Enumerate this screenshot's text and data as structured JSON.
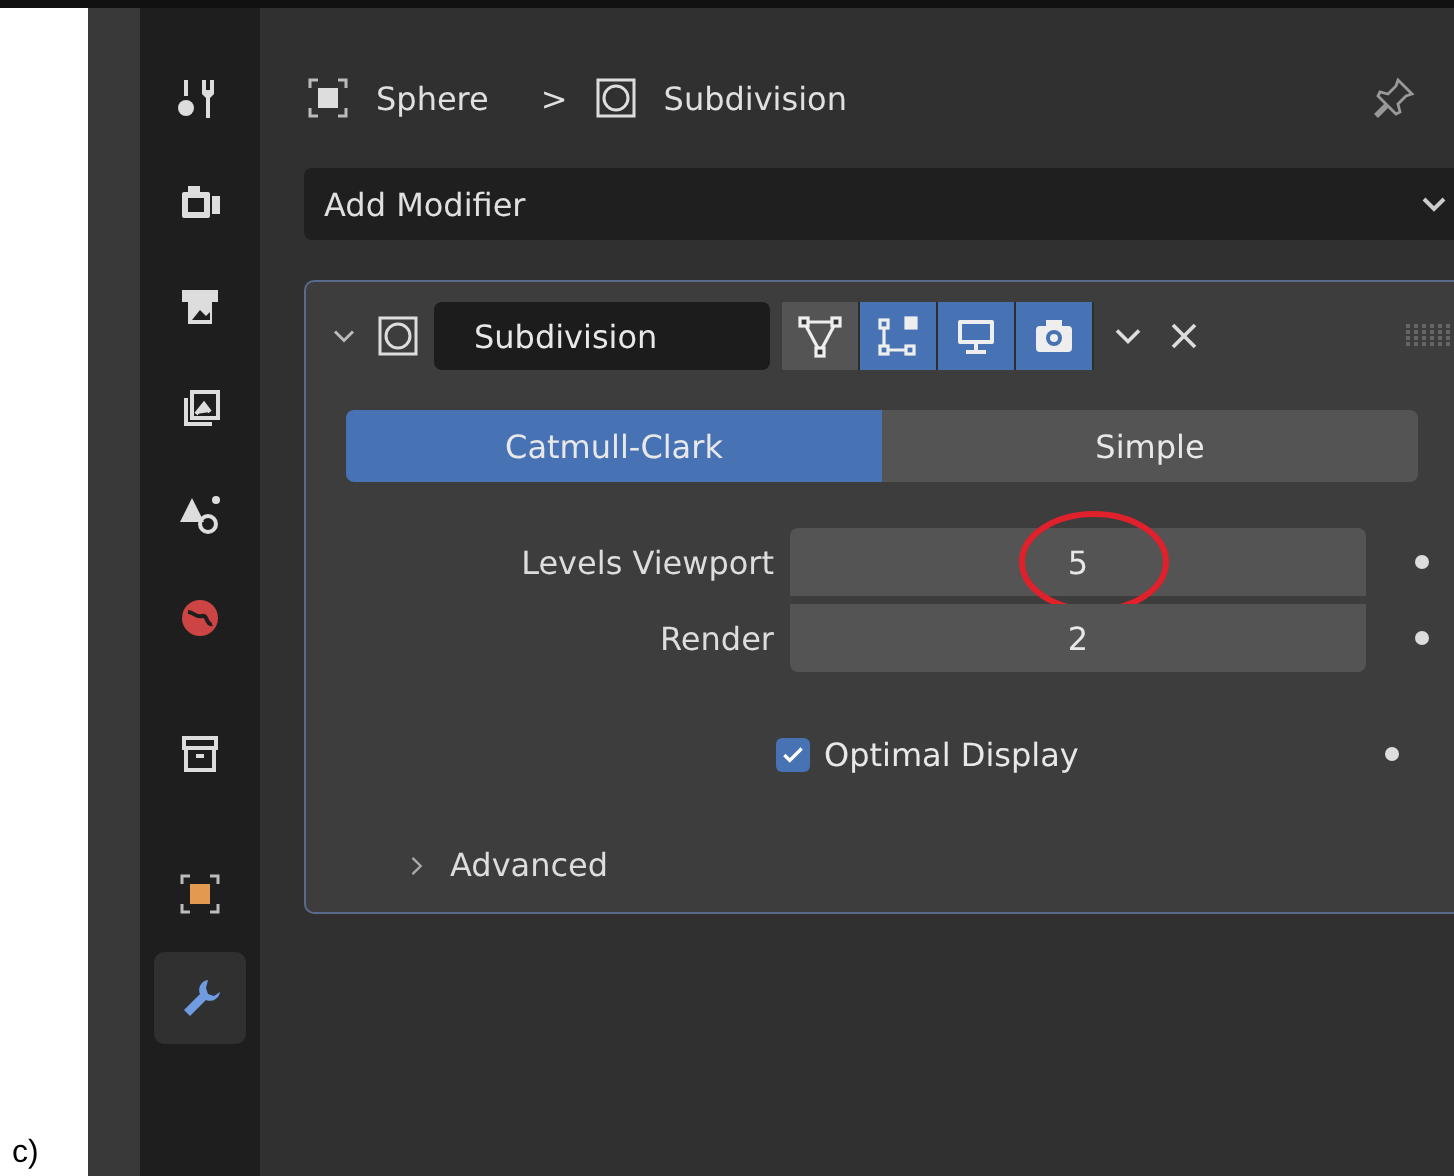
{
  "caption": "c)",
  "sidebar": {
    "tabs": [
      {
        "kind": "tool",
        "selected": false
      },
      {
        "kind": "render",
        "selected": false
      },
      {
        "kind": "output",
        "selected": false
      },
      {
        "kind": "view-layer",
        "selected": false
      },
      {
        "kind": "scene",
        "selected": false
      },
      {
        "kind": "world",
        "selected": false
      },
      {
        "kind": "collection",
        "selected": false
      },
      {
        "kind": "object",
        "selected": false
      },
      {
        "kind": "modifier",
        "selected": true
      }
    ]
  },
  "breadcrumb": {
    "object": "Sphere",
    "separator": ">",
    "modifier": "Subdivision"
  },
  "add_modifier": {
    "label": "Add Modifier"
  },
  "modifier": {
    "expanded": true,
    "name": "Subdivision",
    "toggles": [
      {
        "kind": "edit-cage",
        "on": false
      },
      {
        "kind": "edit-mode",
        "on": true
      },
      {
        "kind": "viewport",
        "on": true
      },
      {
        "kind": "render",
        "on": true
      }
    ],
    "method": [
      {
        "label": "Catmull-Clark",
        "selected": true
      },
      {
        "label": "Simple",
        "selected": false
      }
    ],
    "fields": [
      {
        "label": "Levels Viewport",
        "value": "5",
        "annotated": true
      },
      {
        "label": "Render",
        "value": "2",
        "annotated": false
      }
    ],
    "optimal_display": {
      "label": "Optimal Display",
      "checked": true
    },
    "advanced": {
      "label": "Advanced",
      "expanded": false
    }
  }
}
